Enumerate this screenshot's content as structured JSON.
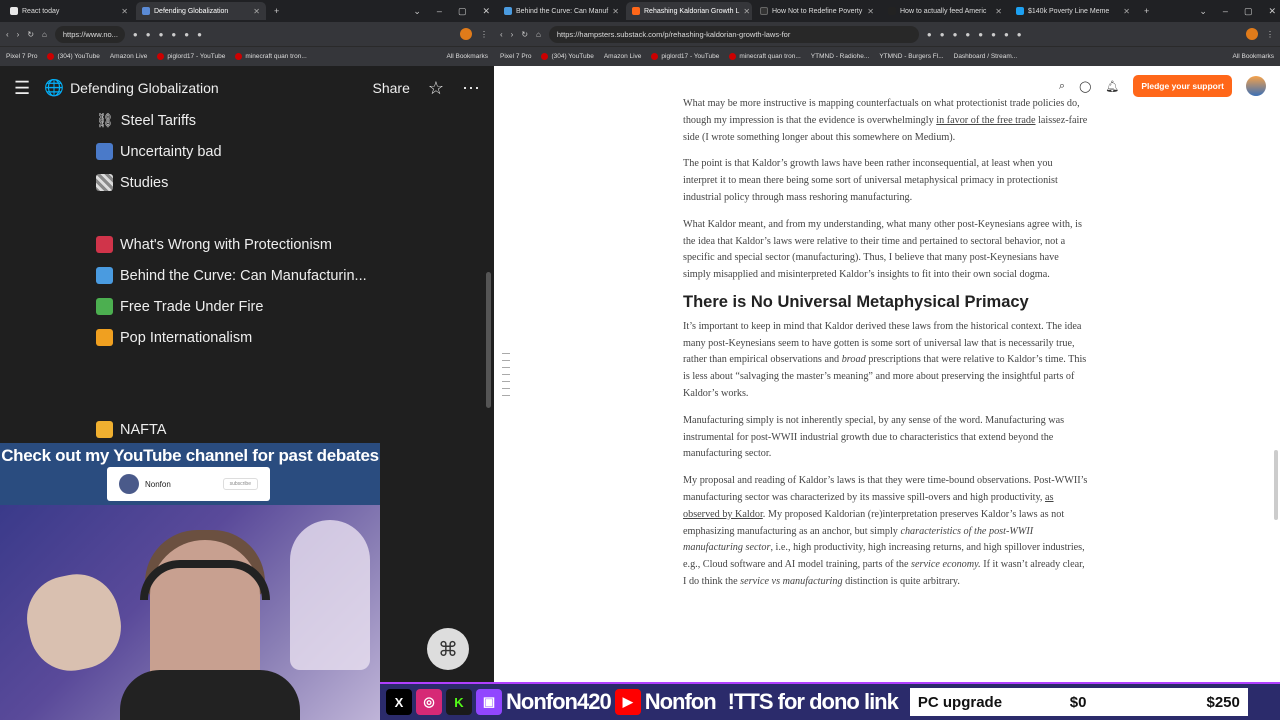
{
  "left_browser": {
    "tabs": [
      {
        "label": "React today",
        "color": "#e8e8e8"
      },
      {
        "label": "Defending Globalization",
        "color": "#5b8bd6",
        "active": true
      }
    ],
    "url": "https://www.no...",
    "bookmarks": [
      "Pixel 7 Pro",
      "(304) YouTube",
      "Amazon Live",
      "piglord17 - YouTube",
      "minecraft quan tron...",
      "All Bookmarks"
    ]
  },
  "notion": {
    "page_title": "Defending Globalization",
    "share_label": "Share",
    "items": [
      {
        "label": "Steel Tariffs",
        "emoji": "⛓",
        "color": "#aaa"
      },
      {
        "label": "Uncertainty bad",
        "emoji": "📊",
        "color": "#4a7ac9"
      },
      {
        "label": "Studies",
        "emoji": "🏁",
        "color": "#888"
      },
      {
        "label": "What's Wrong with Protectionism",
        "emoji": "",
        "color": "#d0344a"
      },
      {
        "label": "Behind the Curve: Can Manufacturin...",
        "emoji": "",
        "color": "#4a9be0"
      },
      {
        "label": "Free Trade Under Fire",
        "emoji": "",
        "color": "#4caf50"
      },
      {
        "label": "Pop Internationalism",
        "emoji": "",
        "color": "#f0a020"
      },
      {
        "label": "NAFTA",
        "emoji": "👐",
        "color": "#f0b030"
      }
    ]
  },
  "overlay": {
    "banner_text": "Check out my YouTube channel for past debates",
    "card_name": "Nonfon",
    "card_button": "subscribe",
    "social_name_1": "Nonfon420",
    "social_name_2": "Nonfon",
    "tts_text": "!TTS for dono link",
    "goal_label": "PC upgrade",
    "goal_current": "$0",
    "goal_target": "$250"
  },
  "right_browser": {
    "tabs": [
      {
        "label": "Behind the Curve: Can Manuf",
        "color": "#4a9be0"
      },
      {
        "label": "Rehashing Kaldorian Growth L",
        "color": "#ff6719",
        "active": true
      },
      {
        "label": "How Not to Redefine Poverty",
        "color": "#333"
      },
      {
        "label": "How to actually feed Americ",
        "color": "#222"
      },
      {
        "label": "$140k Poverty Line Meme",
        "color": "#1da1f2"
      }
    ],
    "url": "https://hampsters.substack.com/p/rehashing-kaldorian-growth-laws-for",
    "bookmarks": [
      "Pixel 7 Pro",
      "(304) YouTube",
      "Amazon Live",
      "piglord17 - YouTube",
      "minecraft quan tron...",
      "YTMND - Radiohe...",
      "YTMND - Burgers Fl...",
      "Dashboard / Stream...",
      "All Bookmarks"
    ]
  },
  "substack": {
    "pledge_label": "Pledge your support",
    "p0a": "What may be more instructive is mapping counterfactuals on what protectionist trade policies do, though my impression is that the evidence is overwhelmingly ",
    "p0link": "in favor of the free trade",
    "p0b": " laissez-faire side (I wrote something longer about this somewhere on Medium).",
    "p1": "The point is that Kaldor’s growth laws have been rather inconsequential, at least when you interpret it to mean there being some sort of universal metaphysical primacy in protectionist industrial policy through mass reshoring manufacturing.",
    "p2": "What Kaldor meant, and from my understanding, what many other post-Keynesians agree with, is the idea that Kaldor’s laws were relative to their time and pertained to sectoral behavior, not a specific and special sector (manufacturing). Thus, I believe that many post-Keynesians have simply misapplied and misinterpreted Kaldor’s insights to fit into their own social dogma.",
    "h1": "There is No Universal Metaphysical Primacy",
    "p3a": "It’s important to keep in mind that Kaldor derived these laws from the historical context. The idea many post-Keynesians seem to have gotten is some sort of universal law that is necessarily true, rather than empirical observations and ",
    "p3em": "broad",
    "p3b": " prescriptions that were relative to Kaldor’s time. This is less about “salvaging the master’s meaning” and more about preserving the insightful parts of Kaldor’s works.",
    "p4": "Manufacturing simply is not inherently special, by any sense of the word. Manufacturing was instrumental for post-WWII industrial growth due to characteristics that extend beyond the manufacturing sector.",
    "p5a": "My proposal and reading of Kaldor’s laws is that they were time-bound observations. Post-WWII’s manufacturing sector was characterized by its massive spill-overs and high productivity, ",
    "p5link": "as observed by Kaldor",
    "p5b": ". My proposed Kaldorian (re)interpretation preserves Kaldor’s laws as not emphasizing manufacturing as an anchor, but simply ",
    "p5em": "characteristics of the post-WWII manufacturing sector",
    "p5c": ", i.e., high productivity, high increasing returns, and high spillover industries, e.g., Cloud software and AI model training, parts of the ",
    "p5em2": "service economy.",
    "p5d": " If it wasn’t already clear, I do think the ",
    "p5em3": "service vs manufacturing",
    "p5e": " distinction is quite arbitrary."
  }
}
